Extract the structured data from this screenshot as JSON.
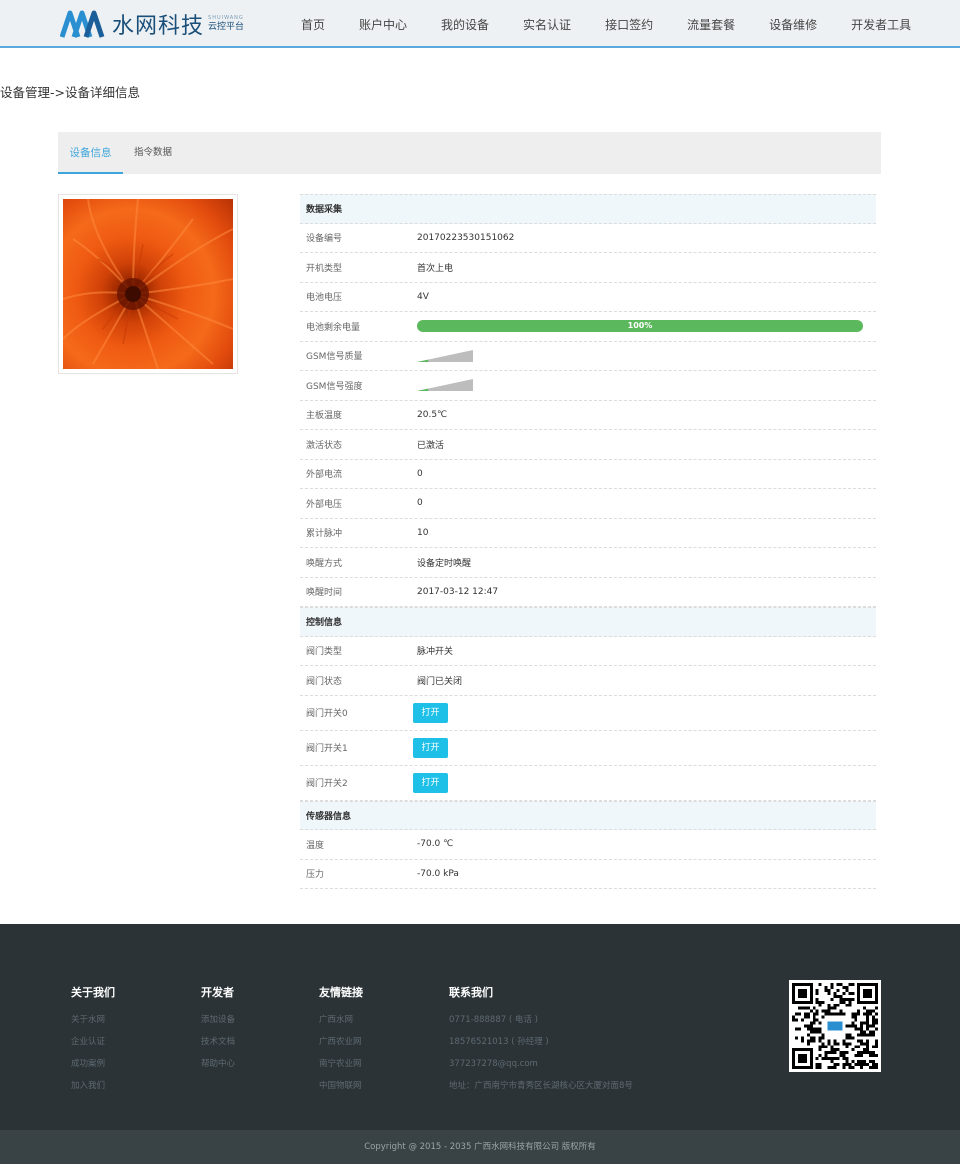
{
  "header": {
    "logo_name": "水网科技",
    "logo_pinyin": "SHUIWANG",
    "logo_tag": "云控平台",
    "nav": [
      "首页",
      "账户中心",
      "我的设备",
      "实名认证",
      "接口签约",
      "流量套餐",
      "设备维修",
      "开发者工具"
    ]
  },
  "breadcrumb": "设备管理->设备详细信息",
  "tabs": [
    "设备信息",
    "指令数据"
  ],
  "sections": {
    "data": "数据采集",
    "control": "控制信息",
    "sensor": "传感器信息"
  },
  "data_rows": [
    {
      "label": "设备编号",
      "value": "20170223530151062"
    },
    {
      "label": "开机类型",
      "value": "首次上电"
    },
    {
      "label": "电池电压",
      "value": "4V"
    },
    {
      "label": "电池剩余电量",
      "value": "100%"
    },
    {
      "label": "GSM信号质量",
      "value": ""
    },
    {
      "label": "GSM信号强度",
      "value": ""
    },
    {
      "label": "主板温度",
      "value": "20.5℃"
    },
    {
      "label": "激活状态",
      "value": "已激活"
    },
    {
      "label": "外部电流",
      "value": "0"
    },
    {
      "label": "外部电压",
      "value": "0"
    },
    {
      "label": "累计脉冲",
      "value": "10"
    },
    {
      "label": "唤醒方式",
      "value": "设备定时唤醒"
    },
    {
      "label": "唤醒时间",
      "value": "2017-03-12 12:47"
    }
  ],
  "battery_level": 1.0,
  "gsm_quality_level": 0.2,
  "gsm_strength_level": 0.2,
  "control_rows": [
    {
      "label": "阀门类型",
      "value": "脉冲开关"
    },
    {
      "label": "阀门状态",
      "value": "阀门已关闭"
    }
  ],
  "valve_rows": [
    {
      "label": "阀门开关0",
      "button": "打开"
    },
    {
      "label": "阀门开关1",
      "button": "打开"
    },
    {
      "label": "阀门开关2",
      "button": "打开"
    }
  ],
  "sensor_rows": [
    {
      "label": "温度",
      "value": "-70.0 ℃"
    },
    {
      "label": "压力",
      "value": "-70.0 kPa"
    }
  ],
  "footer": {
    "cols": [
      {
        "title": "关于我们",
        "items": [
          "关于水网",
          "企业认证",
          "成功案例",
          "加入我们"
        ]
      },
      {
        "title": "开发者",
        "items": [
          "添加设备",
          "技术文档",
          "帮助中心"
        ]
      },
      {
        "title": "友情链接",
        "items": [
          "广西水网",
          "广西农业网",
          "南宁农业网",
          "中国物联网"
        ]
      },
      {
        "title": "联系我们",
        "items": [
          "0771-888887 ( 电话 )",
          "18576521013 ( 孙经理 )",
          "377237278@qq.com",
          "地址：广西南宁市青秀区长湖核心区大厦对面8号"
        ]
      }
    ],
    "copyright": "Copyright @ 2015 - 2035 广西水网科技有限公司 版权所有"
  },
  "colors": {
    "accent": "#3ea6dc",
    "progress": "#5cb85c",
    "button": "#1ec0e8",
    "footer_bg": "#2b3337"
  }
}
